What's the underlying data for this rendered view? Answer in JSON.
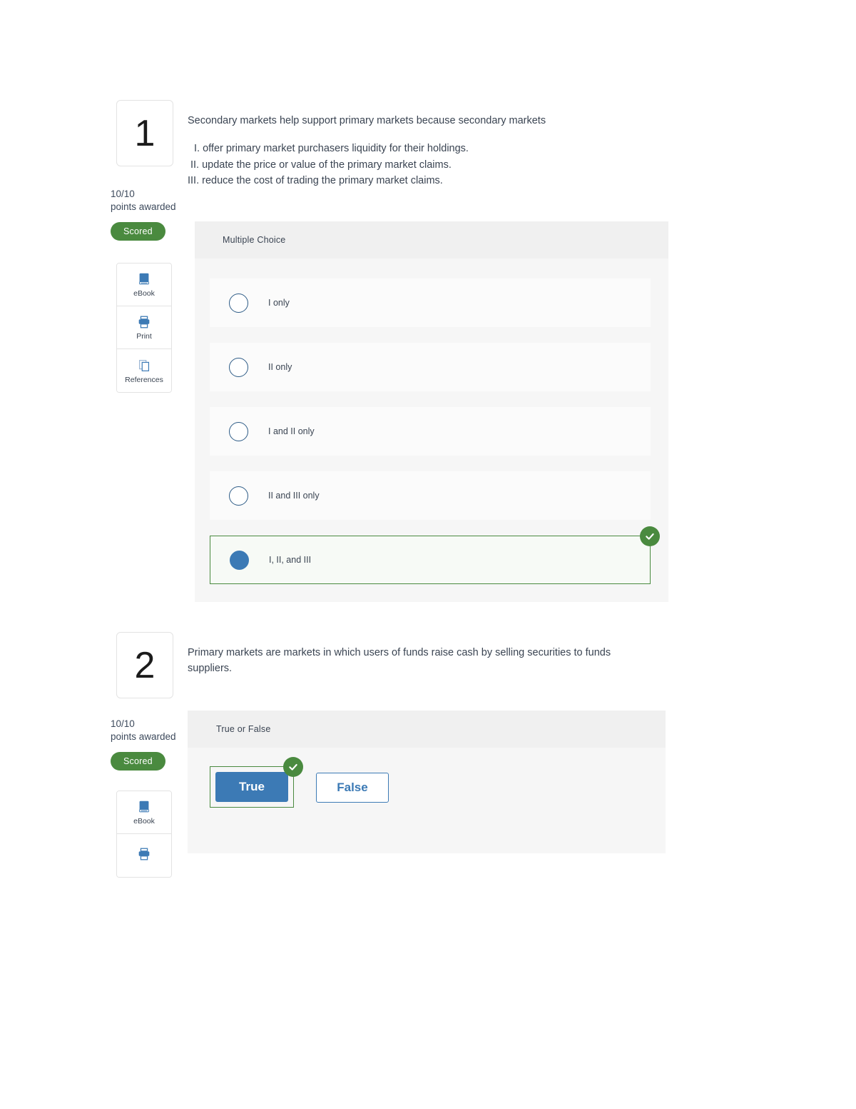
{
  "questions": [
    {
      "number": "1",
      "stem": "Secondary markets help support primary markets because secondary markets",
      "roman_1": "I. offer primary market purchasers liquidity for their holdings.",
      "roman_2": "II. update the price or value of the primary market claims.",
      "roman_3": "III. reduce the cost of trading the primary market claims.",
      "points": "10/10",
      "points_label": "points awarded",
      "status_badge": "Scored",
      "tools": [
        {
          "label": "eBook",
          "icon": "ebook-icon"
        },
        {
          "label": "Print",
          "icon": "print-icon"
        },
        {
          "label": "References",
          "icon": "references-icon"
        }
      ],
      "answer_type": "Multiple Choice",
      "options": [
        {
          "label": "I only",
          "selected": false
        },
        {
          "label": "II only",
          "selected": false
        },
        {
          "label": "I and II only",
          "selected": false
        },
        {
          "label": "II and III only",
          "selected": false
        },
        {
          "label": "I, II, and III",
          "selected": true
        }
      ]
    },
    {
      "number": "2",
      "stem": "Primary markets are markets in which users of funds raise cash by selling securities to funds suppliers.",
      "points": "10/10",
      "points_label": "points awarded",
      "status_badge": "Scored",
      "tools": [
        {
          "label": "eBook",
          "icon": "ebook-icon"
        },
        {
          "label": "",
          "icon": "print-icon"
        }
      ],
      "answer_type": "True or False",
      "true_label": "True",
      "false_label": "False",
      "selected": "True"
    }
  ],
  "colors": {
    "scored_green": "#4a8a3f",
    "selection_blue": "#3c7ab5",
    "panel_bg": "#f6f6f6",
    "panel_header_bg": "#f0f0f0",
    "option_bg": "#fbfbfb"
  }
}
